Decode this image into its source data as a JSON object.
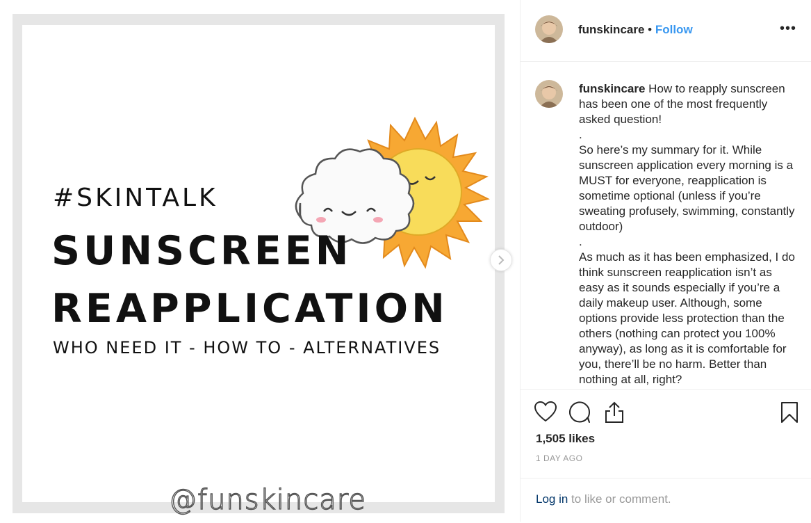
{
  "image": {
    "hashtag": "#SKINTALK",
    "title_line1": "SUNSCREEN",
    "title_line2": "REAPPLICATION",
    "subtitle": "WHO NEED IT - HOW TO - ALTERNATIVES",
    "watermark": "@funskincare"
  },
  "header": {
    "username": "funskincare",
    "separator": " • ",
    "follow_label": "Follow",
    "more_label": "•••"
  },
  "caption": {
    "username": "funskincare",
    "paragraphs": [
      " How to reapply sunscreen has been one of the most frequently asked question!",
      ".",
      "So here’s my summary for it. While sunscreen application every morning is a MUST for everyone, reapplication is sometime optional (unless if you’re sweating profusely, swimming, constantly outdoor)",
      ".",
      "As much as it has been emphasized, I do think sunscreen reapplication isn’t as easy as it sounds especially if you’re a daily makeup user. Although, some options provide less protection than the others (nothing can protect you 100% anyway), as long as it is comfortable for you, there’ll be no harm. Better than nothing at all, right?"
    ]
  },
  "engagement": {
    "likes": "1,505 likes",
    "timestamp": "1 DAY AGO"
  },
  "footer": {
    "login_link": "Log in",
    "login_rest": " to like or comment."
  },
  "icons": {
    "like": "heart-icon",
    "comment": "comment-icon",
    "share": "share-icon",
    "save": "bookmark-icon",
    "next": "chevron-right-icon"
  },
  "colors": {
    "follow": "#3897f0",
    "login_link": "#003569",
    "sun": "#f7a833",
    "sun_face": "#f8dc5a"
  }
}
